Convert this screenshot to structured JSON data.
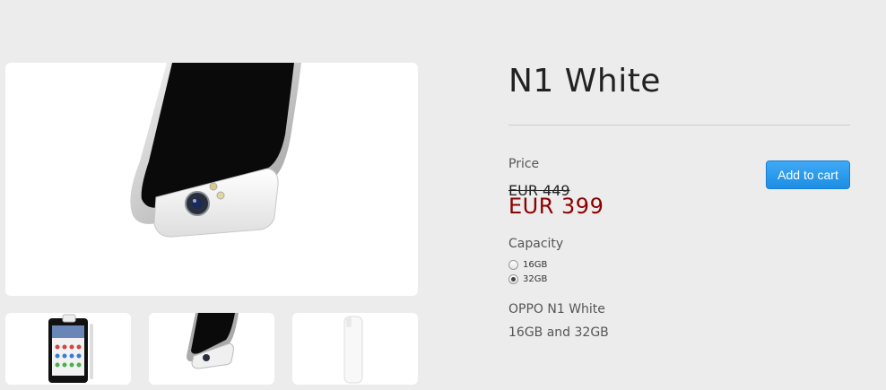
{
  "product": {
    "title": "N1 White",
    "price_label": "Price",
    "old_price": "EUR 449",
    "new_price": "EUR 399",
    "add_to_cart": "Add to cart",
    "capacity_label": "Capacity",
    "capacity_options": [
      {
        "label": "16GB",
        "selected": false
      },
      {
        "label": "32GB",
        "selected": true
      }
    ],
    "description": [
      "OPPO N1 White",
      "16GB and 32GB"
    ]
  },
  "gallery": {
    "main_image": "phone-rotating-camera-closeup",
    "thumbnails": [
      "phone-front-view",
      "phone-camera-closeup",
      "phone-side-view"
    ]
  },
  "colors": {
    "background": "#ececec",
    "new_price": "#8b0000",
    "button": "#2b9cee"
  }
}
